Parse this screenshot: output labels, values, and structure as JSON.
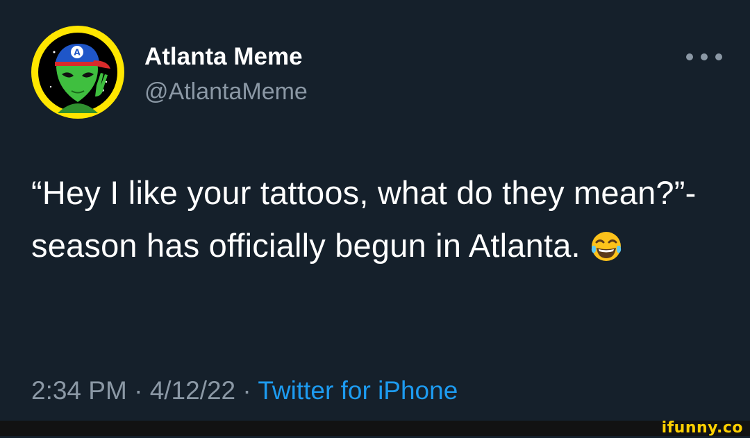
{
  "tweet": {
    "author": {
      "display_name": "Atlanta Meme",
      "handle": "@AtlantaMeme",
      "avatar": "alien-avatar-icon"
    },
    "more_icon": "more-horizontal-icon",
    "text": "“Hey I like your tattoos, what do they mean?”- season has officially begun in Atlanta.",
    "emoji": "face-with-tears-of-joy-icon",
    "time": "2:34 PM",
    "date": "4/12/22",
    "separator": "·",
    "source": "Twitter for iPhone"
  },
  "watermark": {
    "text": "ifunny.co"
  },
  "colors": {
    "background": "#15202b",
    "secondary_text": "#8b98a5",
    "link": "#1d9bf0",
    "avatar_ring": "#ffe600",
    "watermark": "#ffd000"
  }
}
